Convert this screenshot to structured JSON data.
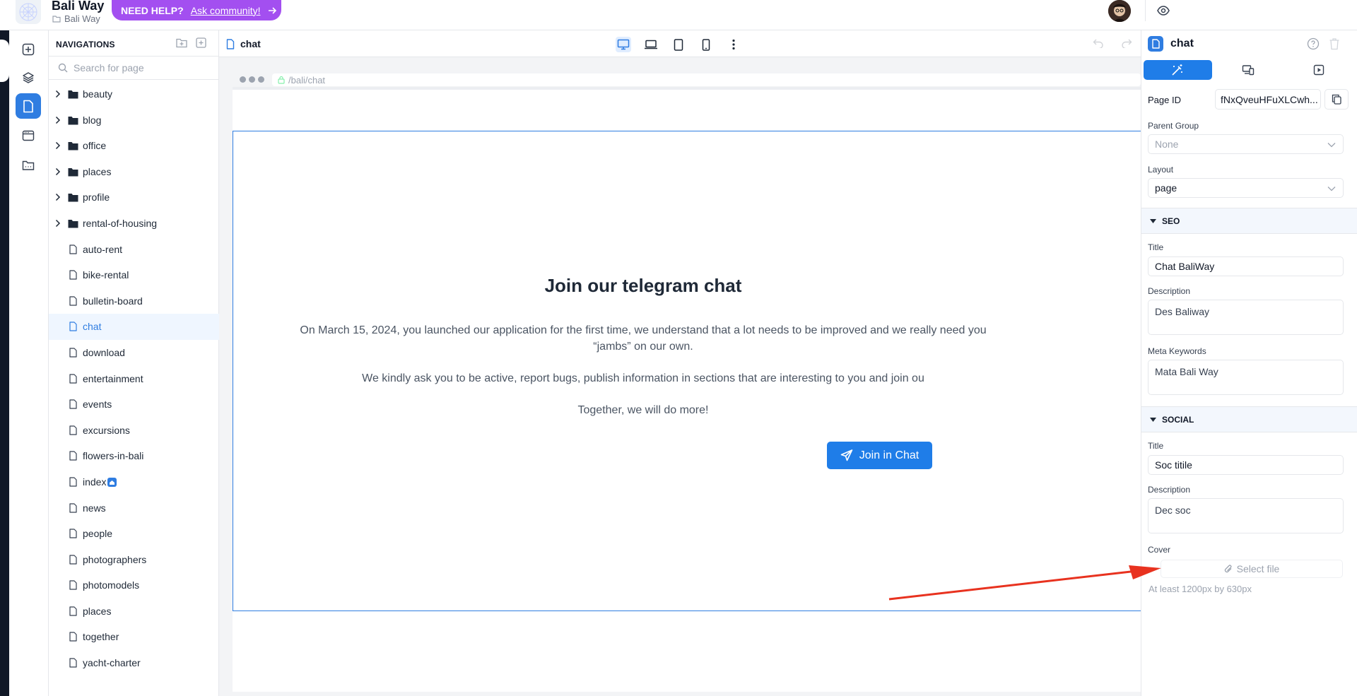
{
  "app": {
    "title": "Bali Way",
    "subtitle": "Bali Way"
  },
  "help": {
    "need": "NEED HELP?",
    "ask": "Ask community!"
  },
  "nav": {
    "heading": "NAVIGATIONS",
    "search_placeholder": "Search for page",
    "folders": [
      "beauty",
      "blog",
      "office",
      "places",
      "profile",
      "rental-of-housing"
    ],
    "pages": [
      "auto-rent",
      "bike-rental",
      "bulletin-board",
      "chat",
      "download",
      "entertainment",
      "events",
      "excursions",
      "flowers-in-bali",
      "index",
      "news",
      "people",
      "photographers",
      "photomodels",
      "places",
      "together",
      "yacht-charter"
    ],
    "active_page": "chat",
    "home_page": "index"
  },
  "canvas": {
    "page_tab": "chat",
    "url": "/bali/chat",
    "hero_title": "Join our telegram chat",
    "hero_line1": "On March 15, 2024, you launched our application for the first time, we understand that a lot needs to be improved and we really need you",
    "hero_line2": "“jambs” on our own.",
    "hero_line3": "We kindly ask you to be active, report bugs, publish information in sections that are interesting to you and join ou",
    "hero_line4": "Together, we will do more!",
    "join_button": "Join in Chat"
  },
  "panel": {
    "title": "chat",
    "page_id_label": "Page ID",
    "page_id": "fNxQveuHFuXLCwh...",
    "parent_group_label": "Parent Group",
    "parent_group_value": "None",
    "layout_label": "Layout",
    "layout_value": "page",
    "seo_section": "SEO",
    "seo_title_label": "Title",
    "seo_title": "Chat BaliWay",
    "seo_desc_label": "Description",
    "seo_desc": "Des Baliway",
    "meta_keywords_label": "Meta Keywords",
    "meta_keywords": "Mata Bali Way",
    "social_section": "SOCIAL",
    "social_title_label": "Title",
    "social_title": "Soc titile",
    "social_desc_label": "Description",
    "social_desc": "Dec soc",
    "cover_label": "Cover",
    "cover_button": "Select file",
    "cover_hint": "At least 1200px by 630px"
  },
  "colors": {
    "accent": "#2f7de1",
    "help_pill": "#a34ff0",
    "annotation_arrow": "#e8321f"
  },
  "icons": [
    "add-icon",
    "layers-icon",
    "page-icon",
    "browser-icon",
    "folder-icon",
    "desktop-icon",
    "laptop-icon",
    "tablet-icon",
    "mobile-icon",
    "more-icon",
    "undo-icon",
    "redo-icon",
    "eye-icon",
    "help-icon",
    "trash-icon",
    "copy-icon",
    "paperclip-icon",
    "send-icon"
  ]
}
